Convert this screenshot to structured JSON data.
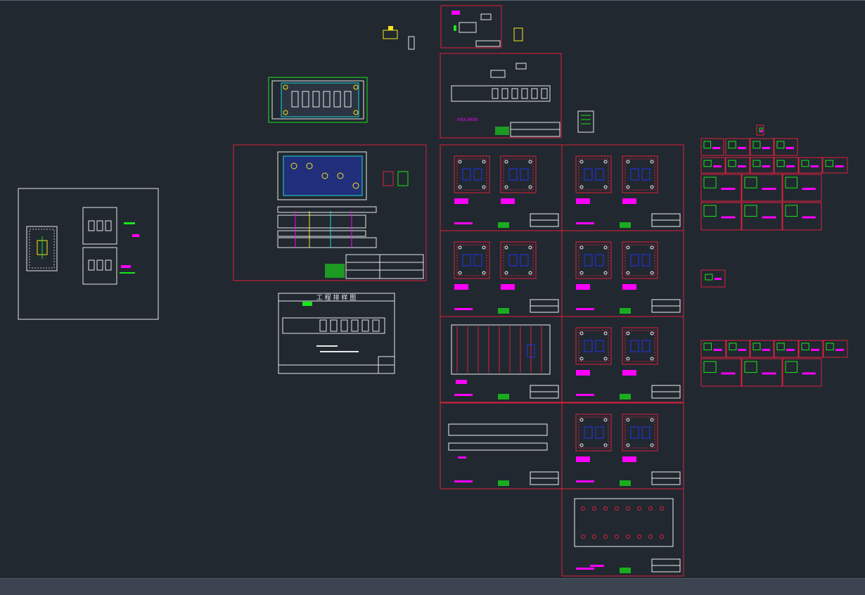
{
  "app": {
    "kind": "CAD model space"
  },
  "drawings": {
    "process_sheet_title": "工 程 排 样 图",
    "mold_label": "XXX-SK00"
  },
  "colors": {
    "background": "#212830",
    "frame": "#e0203c",
    "magenta": "#ff00ff",
    "green": "#19e619",
    "cyan": "#19d8d8",
    "blue": "#2233ee",
    "white": "#f0f0f0",
    "yellow": "#f5e61e",
    "statusbar": "#3b4450"
  }
}
